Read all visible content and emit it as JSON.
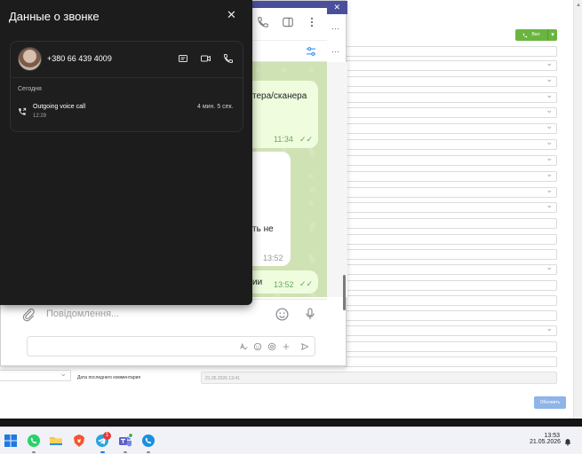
{
  "crm": {
    "call_button_label": "Вал",
    "last_comment_label": "Дата последнего комментария",
    "last_comment_value": "21.05.2026 13:41",
    "update_button": "Обновить"
  },
  "telegram": {
    "compose_placeholder": "Повідомлення...",
    "messages": [
      {
        "text": "тера/сканера",
        "time": "11:34",
        "ticks": "✓✓"
      },
      {
        "text": "ть не",
        "time": "13:52"
      },
      {
        "text": "ии",
        "time": "13:52",
        "ticks": "✓✓"
      }
    ],
    "more_glyph": "···",
    "close_glyph": "✕"
  },
  "call_panel": {
    "title": "Данные о звонке",
    "close_glyph": "✕",
    "phone_number": "+380 66 439 4009",
    "section_label": "Сегодня",
    "call": {
      "type": "Outgoing voice call",
      "time": "12:29",
      "duration": "4 мин. 5 сек."
    }
  },
  "taskbar": {
    "time": "13:53",
    "date": "21.05.2026",
    "apps": [
      "windows-start-icon",
      "whatsapp-icon",
      "file-explorer-icon",
      "brave-browser-icon",
      "telegram-icon",
      "teams-icon",
      "phone-link-icon"
    ],
    "telegram_badge": "1"
  },
  "colors": {
    "panel_bg": "#1c1c1c",
    "telegram_header": "#4a4f9c",
    "call_green": "#6ab53f",
    "update_blue": "#8eb4e8",
    "chat_bg": "#cfe2b4",
    "outgoing_bubble": "#effdde"
  }
}
